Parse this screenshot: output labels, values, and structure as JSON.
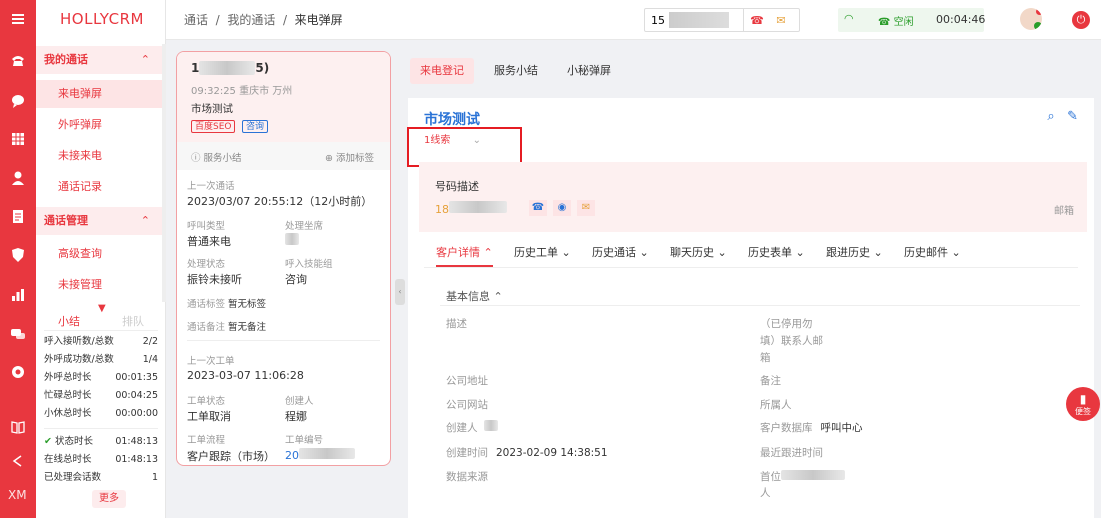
{
  "app": {
    "logo": "HOLLYCRM"
  },
  "rail": {
    "bottom_label": "XM"
  },
  "menu": {
    "group1": "我的通话",
    "items1": [
      "来电弹屏",
      "外呼弹屏",
      "未接来电",
      "通话记录"
    ],
    "group2": "通话管理",
    "items2": [
      "高级查询",
      "未接管理"
    ]
  },
  "summary": {
    "tab_active": "小结",
    "tab_other": "排队",
    "stats_a": [
      {
        "k": "呼入接听数/总数",
        "v": "2/2"
      },
      {
        "k": "外呼成功数/总数",
        "v": "1/4"
      },
      {
        "k": "外呼总时长",
        "v": "00:01:35"
      },
      {
        "k": "忙碌总时长",
        "v": "00:04:25"
      },
      {
        "k": "小休总时长",
        "v": "00:00:00"
      }
    ],
    "stats_b": [
      {
        "k": "状态时长",
        "v": "01:48:13"
      },
      {
        "k": "在线总时长",
        "v": "01:48:13"
      },
      {
        "k": "已处理会话数",
        "v": "1"
      }
    ],
    "more": "更多"
  },
  "topbar": {
    "breadcrumb": [
      "通话",
      "我的通话",
      "来电弹屏"
    ],
    "phone_value": "15",
    "status": "空闲",
    "timer": "00:04:46"
  },
  "call": {
    "number_prefix": "1",
    "number_suffix": "5)",
    "time_location": "09:32:25 重庆市 万州",
    "project": "市场测试",
    "tags": [
      "百度SEO",
      "咨询"
    ],
    "service_summary": "服务小结",
    "add_tag": "添加标签",
    "last_call": {
      "label": "上一次通话",
      "datetime": "2023/03/07 20:55:12（12小时前）",
      "call_type_label": "呼叫类型",
      "call_type": "普通来电",
      "seat_label": "处理坐席",
      "state_label": "处理状态",
      "state": "振铃未接听",
      "skill_label": "呼入技能组",
      "skill": "咨询",
      "tag_label": "通话标签",
      "tag_value": "暂无标签",
      "note_label": "通话备注",
      "note_value": "暂无备注"
    },
    "last_order": {
      "label": "上一次工单",
      "datetime": "2023-03-07 11:06:28",
      "status_label": "工单状态",
      "status": "工单取消",
      "creator_label": "创建人",
      "creator": "程娜",
      "flow_label": "工单流程",
      "flow": "客户跟踪（市场）",
      "no_label": "工单编号",
      "no_prefix": "20"
    }
  },
  "tabs": [
    "来电登记",
    "服务小结",
    "小秘弹屏"
  ],
  "detail": {
    "title": "市场测试",
    "clue": "1线索",
    "num_desc_label": "号码描述",
    "num_prefix": "18",
    "mailbox": "邮箱",
    "detail_tabs": [
      "客户详情",
      "历史工单",
      "历史通话",
      "聊天历史",
      "历史表单",
      "跟进历史",
      "历史邮件"
    ],
    "basic_info": "基本信息",
    "fields_left": [
      {
        "k": "描述",
        "v": ""
      },
      {
        "k": "公司地址",
        "v": ""
      },
      {
        "k": "公司网站",
        "v": ""
      },
      {
        "k": "创建人",
        "v": ""
      },
      {
        "k": "创建时间",
        "v": "2023-02-09 14:38:51"
      },
      {
        "k": "数据来源",
        "v": ""
      }
    ],
    "right_desc": "（已停用勿填）联系人邮箱",
    "right_desc_lines": [
      "（已停用勿",
      "填）联系人邮",
      "箱"
    ],
    "fields_right": [
      {
        "k": "备注",
        "v": ""
      },
      {
        "k": "所属人",
        "v": ""
      },
      {
        "k": "客户数据库",
        "v": "呼叫中心"
      },
      {
        "k": "最近跟进时间",
        "v": ""
      }
    ],
    "first_contact_prefix": "首位",
    "first_contact_suffix": "人"
  },
  "fab": {
    "label": "便签"
  }
}
